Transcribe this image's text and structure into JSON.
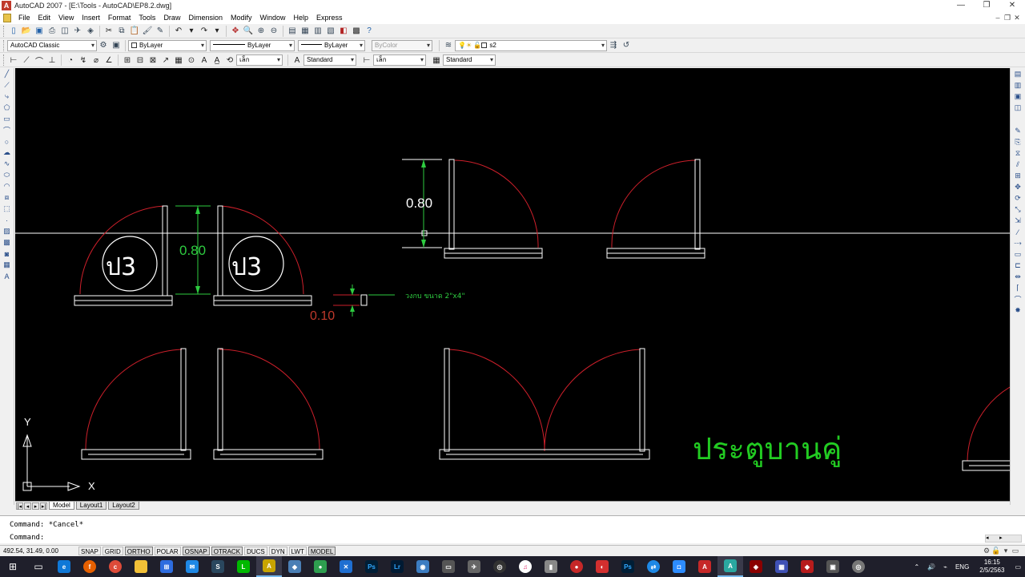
{
  "window": {
    "title": "AutoCAD 2007 - [E:\\Tools - AutoCAD\\EP8.2.dwg]",
    "controls": [
      "—",
      "❐",
      "✕"
    ]
  },
  "menu": {
    "items": [
      "File",
      "Edit",
      "View",
      "Insert",
      "Format",
      "Tools",
      "Draw",
      "Dimension",
      "Modify",
      "Window",
      "Help",
      "Express"
    ]
  },
  "toolbar": {
    "workspace": "AutoCAD Classic",
    "layer_color": "ByLayer",
    "linetype": "ByLayer",
    "lineweight": "ByLayer",
    "plot_style": "ByColor",
    "layer_name": "s2",
    "dim_style": "Standard",
    "text_style_1": "เล็ก",
    "text_style_2": "เล็ก",
    "table_style": "Standard",
    "text_style_name": "Standard"
  },
  "drawing": {
    "dim_080_a": "0.80",
    "dim_080_b": "0.80",
    "dim_010": "0.10",
    "frame_note": "วงกบ ขนาด 2\"x4\"",
    "door_tag_1": "ป3",
    "door_tag_2": "ป3",
    "caption": "ประตูบานคู่",
    "ucs_x": "X",
    "ucs_y": "Y",
    "colors": {
      "background": "#000000",
      "frame": "#ffffff",
      "arc": "#cc1f2a",
      "dim_green": "#2ecc40",
      "dim_red": "#c0392b",
      "caption": "#22cc22"
    }
  },
  "layout_tabs": [
    "Model",
    "Layout1",
    "Layout2"
  ],
  "command": {
    "history": "Command: *Cancel*",
    "prompt": "Command:"
  },
  "status": {
    "coords": "492.54, 31.49, 0.00",
    "buttons": [
      "SNAP",
      "GRID",
      "ORTHO",
      "POLAR",
      "OSNAP",
      "OTRACK",
      "DUCS",
      "DYN",
      "LWT",
      "MODEL"
    ]
  },
  "taskbar": {
    "lang": "ENG",
    "time": "16:15",
    "date": "2/5/2563"
  }
}
